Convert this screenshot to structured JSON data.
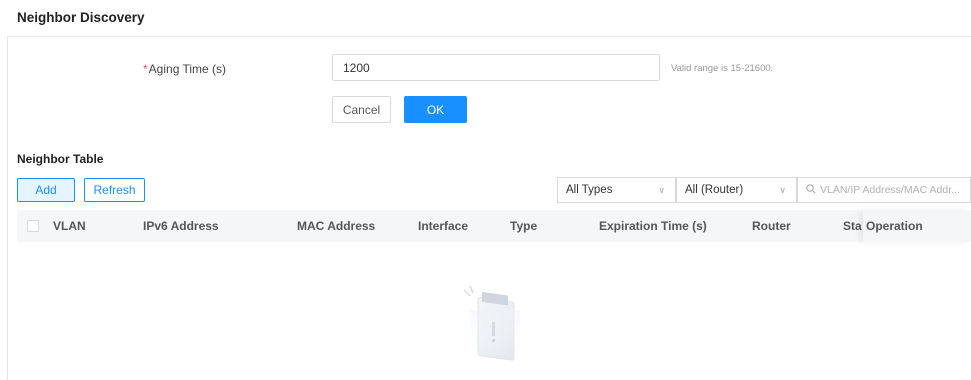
{
  "neighbor_discovery": {
    "title": "Neighbor Discovery",
    "aging_label": "Aging Time (s)",
    "aging_required_mark": "*",
    "aging_value": "1200",
    "aging_hint": "Valid range is 15-21600.",
    "cancel_label": "Cancel",
    "ok_label": "OK"
  },
  "neighbor_table": {
    "title": "Neighbor Table",
    "add_label": "Add",
    "refresh_label": "Refresh",
    "type_filter": "All Types",
    "router_filter": "All (Router)",
    "search_placeholder": "VLAN/IP Address/MAC Addr...",
    "columns": {
      "vlan": "VLAN",
      "ipv6": "IPv6 Address",
      "mac": "MAC Address",
      "interface": "Interface",
      "type": "Type",
      "expiration": "Expiration Time (s)",
      "router": "Router",
      "status": "Sta",
      "operation": "Operation"
    }
  },
  "colors": {
    "primary": "#1890ff",
    "required": "#ff4d4f",
    "header_bg": "#f5f6f7"
  }
}
